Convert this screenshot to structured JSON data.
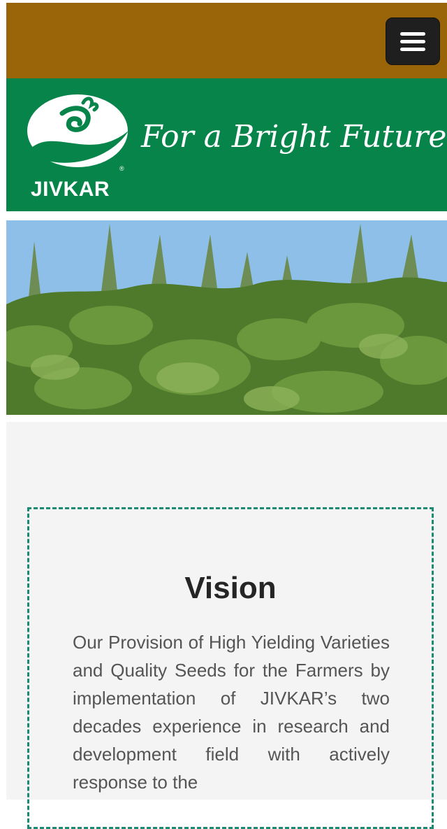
{
  "header": {
    "menu_icon": "hamburger-menu-icon",
    "colors": {
      "topbar": "#9a6409",
      "brand_band": "#07844a"
    }
  },
  "brand": {
    "logo_text": "JIVKAR",
    "registered_mark": "®",
    "tagline": "For a Bright Future"
  },
  "hero": {
    "alt": "castor plants field"
  },
  "vision": {
    "title": "Vision",
    "text": "Our Provision of High Yielding Varieties and Quality Seeds for the Farmers by implementation of JIVKAR’s two decades experience in research and development field with actively response to the",
    "border_color": "#1a8a72"
  }
}
